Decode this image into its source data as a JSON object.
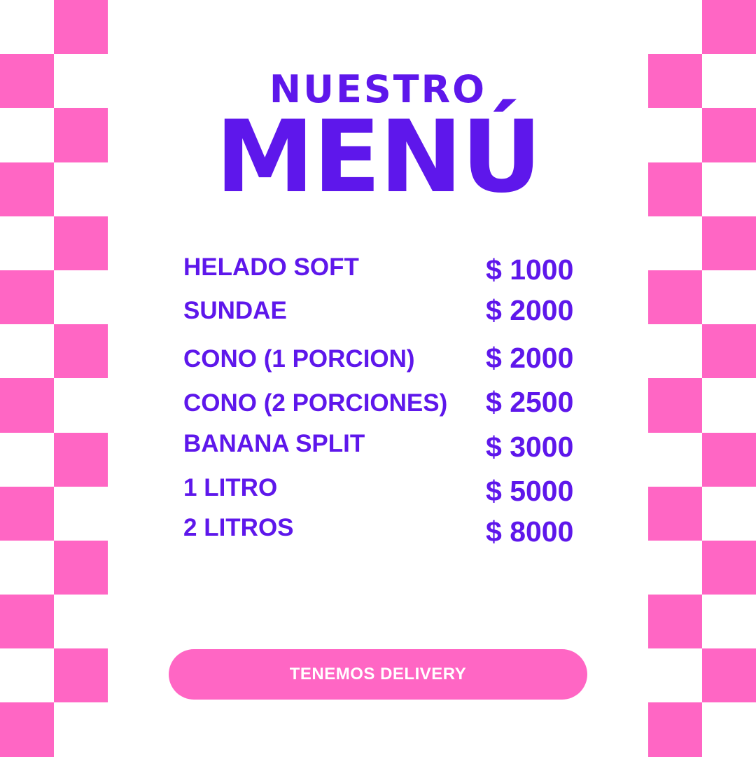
{
  "colors": {
    "accent": "#5e17eb",
    "checker_pink": "#ff66c4",
    "background": "#ffffff"
  },
  "header": {
    "line1": "NUESTRO",
    "line2": "MENÚ"
  },
  "menu": {
    "items": [
      {
        "name": "HELADO SOFT",
        "price": "$ 1000"
      },
      {
        "name": "SUNDAE",
        "price": "$ 2000"
      },
      {
        "name": "CONO (1 PORCION)",
        "price": "$ 2000"
      },
      {
        "name": "CONO (2 PORCIONES)",
        "price": "$ 2500"
      },
      {
        "name": "BANANA SPLIT",
        "price": "$ 3000"
      },
      {
        "name": "1 LITRO",
        "price": "$ 5000"
      },
      {
        "name": "2 LITROS",
        "price": "$ 8000"
      }
    ]
  },
  "footer": {
    "delivery_label": "TENEMOS DELIVERY"
  }
}
